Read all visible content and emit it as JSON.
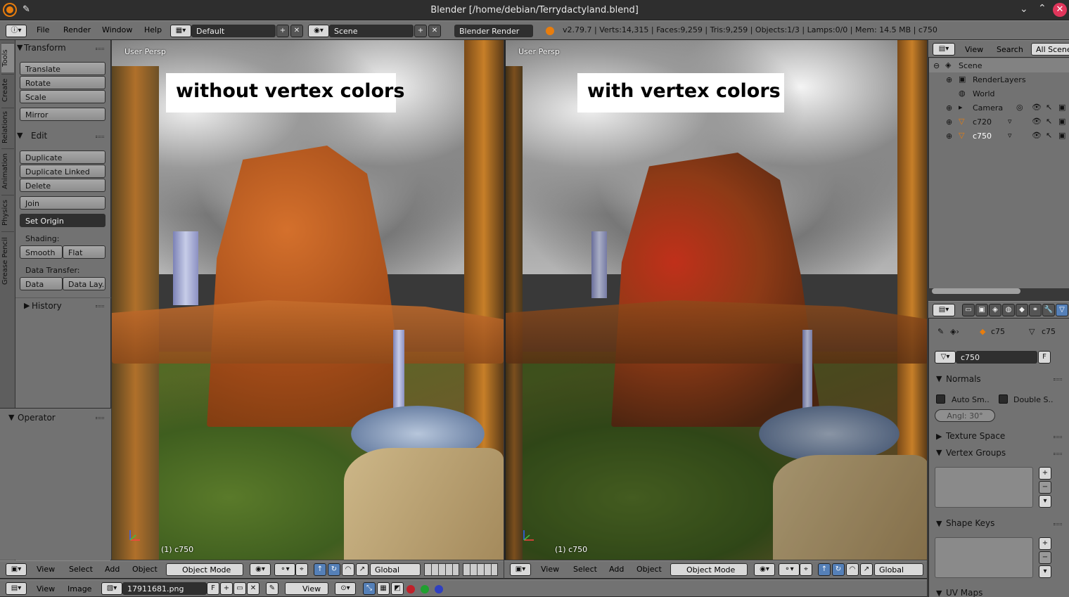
{
  "window": {
    "title": "Blender [/home/debian/Terrydactyland.blend]"
  },
  "info_bar": {
    "menus": [
      "File",
      "Render",
      "Window",
      "Help"
    ],
    "layout": "Default",
    "scene": "Scene",
    "engine": "Blender Render",
    "stats": "v2.79.7 | Verts:14,315 | Faces:9,259 | Tris:9,259 | Objects:1/3 | Lamps:0/0 | Mem: 14.5 MB | c750"
  },
  "tool_shelf": {
    "tabs": [
      "Tools",
      "Create",
      "Relations",
      "Animation",
      "Physics",
      "Grease Pencil"
    ],
    "transform": {
      "title": "Transform",
      "buttons": [
        "Translate",
        "Rotate",
        "Scale",
        "Mirror"
      ]
    },
    "edit": {
      "title": "Edit",
      "buttons": [
        "Duplicate",
        "Duplicate Linked",
        "Delete",
        "Join",
        "Set Origin"
      ]
    },
    "shading": {
      "label": "Shading:",
      "smooth": "Smooth",
      "flat": "Flat"
    },
    "data_transfer": {
      "label": "Data Transfer:",
      "data": "Data",
      "layout": "Data Lay.."
    },
    "history": "History",
    "operator": "Operator"
  },
  "viewports": [
    {
      "label": "User Persp",
      "caption": "without vertex colors",
      "object": "(1) c750"
    },
    {
      "label": "User Persp",
      "caption": "with vertex colors",
      "object": "(1) c750"
    }
  ],
  "viewport_header": {
    "menus": [
      "View",
      "Select",
      "Add",
      "Object"
    ],
    "mode": "Object Mode",
    "orientation": "Global"
  },
  "outliner": {
    "menus": [
      "View",
      "Search"
    ],
    "filter": "All Scenes",
    "items": [
      "Scene",
      "RenderLayers",
      "World",
      "Camera",
      "c720",
      "c750"
    ]
  },
  "properties": {
    "breadcrumb": [
      "c75",
      "c75"
    ],
    "mesh_name": "c750",
    "fake_user": "F",
    "normals": {
      "title": "Normals",
      "auto_smooth": "Auto Sm..",
      "double_sided": "Double S..",
      "angle": "Angl: 30°"
    },
    "panels": [
      "Texture Space",
      "Vertex Groups",
      "Shape Keys",
      "UV Maps"
    ]
  },
  "image_editor": {
    "menus": [
      "View",
      "Image"
    ],
    "image_name": "17911681.png",
    "fake_user": "F",
    "view": "View"
  }
}
